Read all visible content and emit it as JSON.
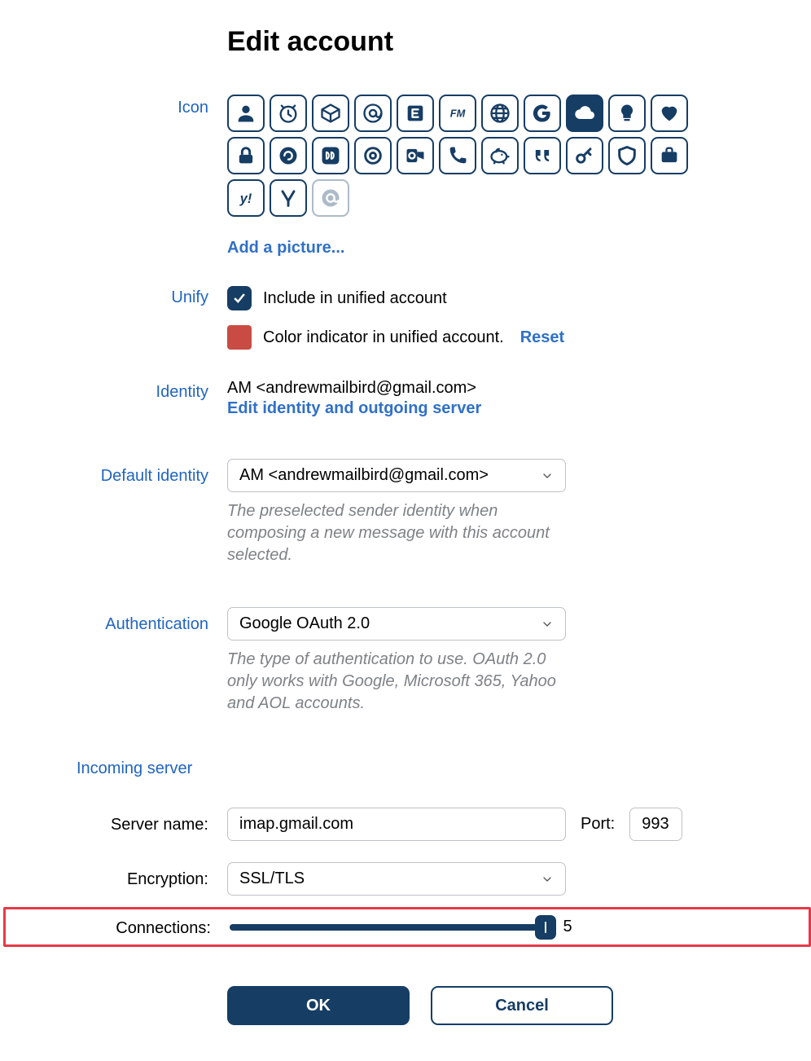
{
  "title": "Edit account",
  "labels": {
    "icon": "Icon",
    "unify": "Unify",
    "identity": "Identity",
    "default_identity": "Default identity",
    "authentication": "Authentication",
    "incoming_server": "Incoming server",
    "server_name": "Server name:",
    "port": "Port:",
    "encryption": "Encryption:",
    "connections": "Connections:"
  },
  "icons": {
    "selected_index": 8,
    "faded_index": 24,
    "names": [
      "person-icon",
      "clock-icon",
      "box-icon",
      "at-icon",
      "exchange-icon",
      "fastmail-icon",
      "globe-icon",
      "google-icon",
      "cloud-icon",
      "bulb-icon",
      "heart-icon",
      "lock-icon",
      "apple-mail-icon",
      "mailru-icon",
      "circle-icon",
      "outlook-icon",
      "phone-icon",
      "piggy-icon",
      "quote-icon",
      "key-icon",
      "shield-icon",
      "briefcase-icon",
      "yahoo-icon",
      "gamma-icon",
      "mail-app-icon"
    ]
  },
  "add_picture": "Add a picture...",
  "unify": {
    "include_label": "Include in unified account",
    "color_label": "Color indicator in unified account.",
    "reset": "Reset",
    "swatch_color": "#C84C43"
  },
  "identity": {
    "text": "AM <andrewmailbird@gmail.com>",
    "edit_link": "Edit identity and outgoing server"
  },
  "default_identity": {
    "value": "AM <andrewmailbird@gmail.com>",
    "hint": "The preselected sender identity when composing a new message with this account selected."
  },
  "authentication": {
    "value": "Google OAuth 2.0",
    "hint": "The type of authentication to use. OAuth 2.0 only works with Google, Microsoft 365, Yahoo and AOL accounts."
  },
  "incoming": {
    "server_name": "imap.gmail.com",
    "port": "993",
    "encryption": "SSL/TLS",
    "connections": "5"
  },
  "buttons": {
    "ok": "OK",
    "cancel": "Cancel"
  }
}
